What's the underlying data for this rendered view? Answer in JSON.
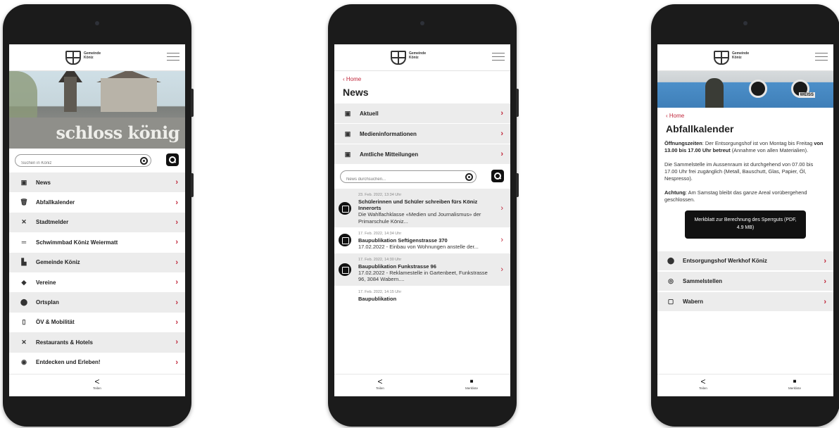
{
  "logo_text": "Gemeinde\nKöniz",
  "phone1": {
    "hero_sign": "schloss könig",
    "search_placeholder": "Suchen in Köniz",
    "menu": [
      {
        "icon": "▣",
        "icon_name": "news-icon",
        "label": "News"
      },
      {
        "icon": "🗑",
        "icon_name": "trash-icon",
        "label": "Abfallkalender"
      },
      {
        "icon": "✕",
        "icon_name": "tools-icon",
        "label": "Stadtmelder"
      },
      {
        "icon": "═",
        "icon_name": "pool-icon",
        "label": "Schwimmbad Köniz Weiermatt"
      },
      {
        "icon": "▙",
        "icon_name": "municipality-icon",
        "label": "Gemeinde Köniz"
      },
      {
        "icon": "◆",
        "icon_name": "clubs-icon",
        "label": "Vereine"
      },
      {
        "icon": "⬤",
        "icon_name": "location-pin-icon",
        "label": "Ortsplan"
      },
      {
        "icon": "▯",
        "icon_name": "transport-icon",
        "label": "ÖV & Mobilität"
      },
      {
        "icon": "✕",
        "icon_name": "restaurant-icon",
        "label": "Restaurants & Hotels"
      },
      {
        "icon": "◉",
        "icon_name": "eye-icon",
        "label": "Entdecken und Erleben!"
      }
    ],
    "share_label": "Teilen"
  },
  "phone2": {
    "back_label": "Home",
    "title": "News",
    "sections": [
      {
        "label": "Aktuell"
      },
      {
        "label": "Medieninformationen"
      },
      {
        "label": "Amtliche Mitteilungen"
      }
    ],
    "search_placeholder": "News durchsuchen...",
    "news": [
      {
        "date": "23. Feb. 2022, 13:34 Uhr",
        "title": "Schülerinnen und Schüler schreiben fürs Köniz Innerorts",
        "text": "Die Wahlfachklasse «Medien und Journalismus» der Primarschule Köniz..."
      },
      {
        "date": "17. Feb. 2022, 14:34 Uhr",
        "title": "Baupublikation Seftigenstrasse 370",
        "text": "17.02.2022 - Einbau von Wohnungen anstelle der..."
      },
      {
        "date": "17. Feb. 2022, 14:30 Uhr",
        "title": "Baupublikation Funkstrasse 96",
        "text": "17.02.2022 - Reklamestelle in Gartenbeet, Funkstrasse 96, 3084 Wabern...."
      },
      {
        "date": "17. Feb. 2022, 14:15 Uhr",
        "title": "Baupublikation",
        "text": ""
      }
    ],
    "share_label": "Teilen",
    "bookmarks_label": "Merkliste"
  },
  "phone3": {
    "hero_label": "WEISS",
    "back_label": "Home",
    "title": "Abfallkalender",
    "p1_label": "Öffnungszeiten",
    "p1_a": ": Der Entsorgungshof ist von Montag bis Freitag ",
    "p1_bold": "von 13.00 bis 17.00 Uhr betreut",
    "p1_b": " (Annahme von allen Materialien).",
    "p2": "Die Sammelstelle im Aussenraum ist durchgehend von 07.00 bis 17.00 Uhr frei zugänglich (Metall, Bauschutt, Glas, Papier, Öl, Nespresso).",
    "p3_label": "Achtung",
    "p3": ": Am Samstag bleibt das ganze Areal vorübergehend geschlossen.",
    "pdf_button": "Merkblatt zur Berechnung des Sperrguts (PDF, 4.9 MB)",
    "locations": [
      {
        "icon": "⬤",
        "icon_name": "location-pin-icon",
        "label": "Entsorgungshof Werkhof Köniz"
      },
      {
        "icon": "◎",
        "icon_name": "collection-point-icon",
        "label": "Sammelstellen"
      },
      {
        "icon": "▢",
        "icon_name": "bin-icon",
        "label": "Wabern"
      }
    ],
    "share_label": "Teilen",
    "bookmarks_label": "Merkliste"
  },
  "chevron": "›",
  "back_chevron": "‹",
  "share_glyph": "<",
  "bookmark_glyph": "■",
  "accent_color": "#c0263a"
}
